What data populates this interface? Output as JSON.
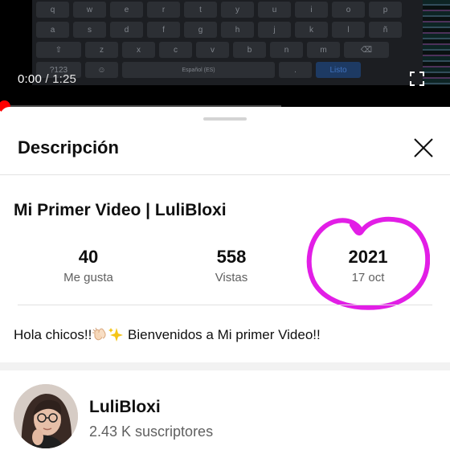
{
  "player": {
    "current_time": "0:00",
    "separator": " / ",
    "duration": "1:25",
    "progress": 0.0,
    "keyboard": {
      "row1": [
        "q",
        "w",
        "e",
        "r",
        "t",
        "y",
        "u",
        "i",
        "o",
        "p"
      ],
      "row2": [
        "a",
        "s",
        "d",
        "f",
        "g",
        "h",
        "j",
        "k",
        "l",
        "ñ"
      ],
      "row3": [
        "z",
        "x",
        "c",
        "v",
        "b",
        "n",
        "m"
      ],
      "row4": [
        "?123",
        "☺",
        "Español (ES)",
        "Listo"
      ]
    }
  },
  "sheet": {
    "title": "Descripción",
    "close_icon": "close-icon"
  },
  "video": {
    "title": "Mi Primer Video | LuliBloxi",
    "stats": [
      {
        "value": "40",
        "label": "Me gusta"
      },
      {
        "value": "558",
        "label": "Vistas"
      },
      {
        "value": "2021",
        "label": "17 oct"
      }
    ],
    "description_before": "Hola chicos!!",
    "description_after": " Bienvenidos a Mi primer Video!!"
  },
  "channel": {
    "name": "LuliBloxi",
    "subscribers": "2.43 K suscriptores"
  },
  "colors": {
    "accent_red": "#ff0000",
    "annotation_magenta": "#e21ee6",
    "text_primary": "#0f0f0f",
    "text_secondary": "#606060"
  }
}
